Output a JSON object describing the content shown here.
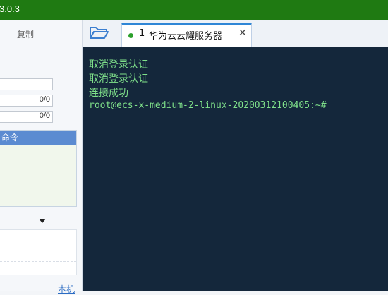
{
  "window": {
    "title_version": "3.0.3",
    "title_color": "#1f7a12"
  },
  "left_panel": {
    "copy_label": "复制",
    "fields": [
      {
        "value": ""
      },
      {
        "value": "0/0"
      },
      {
        "value": "0/0"
      }
    ],
    "command_box": {
      "header": "命令",
      "header_color": "#5b8bd1"
    },
    "local_link": "本机"
  },
  "tabs": {
    "folder_icon": "folder-icon",
    "items": [
      {
        "number": "1",
        "label": "华为云云耀服务器",
        "status": "connected",
        "close": "✕"
      }
    ]
  },
  "terminal": {
    "background": "#14273b",
    "text_color": "#7fe08a",
    "lines": [
      "取消登录认证",
      "取消登录认证",
      "连接成功",
      "root@ecs-x-medium-2-linux-20200312100405:~#"
    ]
  }
}
